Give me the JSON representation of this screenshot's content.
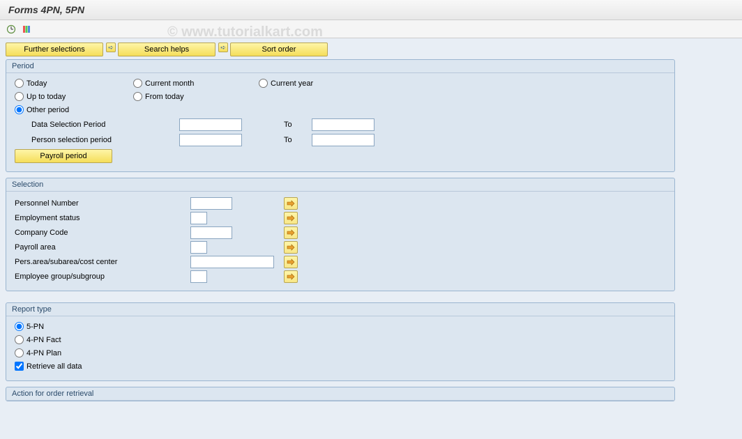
{
  "title": "Forms 4PN, 5PN",
  "watermark": "© www.tutorialkart.com",
  "toolbar_buttons": {
    "further_selections": "Further selections",
    "search_helps": "Search helps",
    "sort_order": "Sort order"
  },
  "period": {
    "title": "Period",
    "radios": {
      "today": "Today",
      "current_month": "Current month",
      "current_year": "Current year",
      "up_to_today": "Up to today",
      "from_today": "From today",
      "other_period": "Other period"
    },
    "selected": "other_period",
    "data_selection_period_label": "Data Selection Period",
    "data_selection_from": "",
    "data_selection_to": "",
    "person_selection_period_label": "Person selection period",
    "person_selection_from": "",
    "person_selection_to": "",
    "to_label": "To",
    "payroll_period_button": "Payroll period"
  },
  "selection": {
    "title": "Selection",
    "fields": [
      {
        "label": "Personnel Number",
        "value": "",
        "width": "w60"
      },
      {
        "label": "Employment status",
        "value": "",
        "width": "w24"
      },
      {
        "label": "Company Code",
        "value": "",
        "width": "w60"
      },
      {
        "label": "Payroll area",
        "value": "",
        "width": "w24"
      },
      {
        "label": "Pers.area/subarea/cost center",
        "value": "",
        "width": "w120"
      },
      {
        "label": "Employee group/subgroup",
        "value": "",
        "width": "w24"
      }
    ]
  },
  "report_type": {
    "title": "Report type",
    "radios": {
      "5pn": "5-PN",
      "4pn_fact": "4-PN Fact",
      "4pn_plan": "4-PN Plan"
    },
    "selected": "5pn",
    "retrieve_all": "Retrieve all data",
    "retrieve_all_checked": true
  },
  "action_section": {
    "title": "Action for order retrieval"
  }
}
